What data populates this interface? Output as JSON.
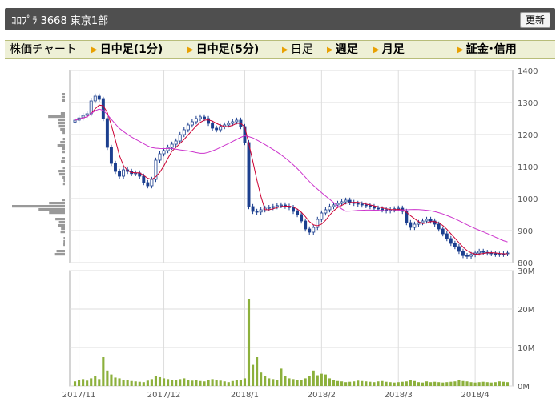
{
  "header": {
    "title": "ｺﾛﾌﾟﾗ  3668  東京1部",
    "refresh_label": "更新"
  },
  "tabs": [
    {
      "label": "株価チャート",
      "link": false
    },
    {
      "label": "日中足(1分)",
      "link": true
    },
    {
      "label": "日中足(5分)",
      "link": true
    },
    {
      "label": "日足",
      "link": false
    },
    {
      "label": "週足",
      "link": true
    },
    {
      "label": "月足",
      "link": true
    },
    {
      "label": "証金･信用",
      "link": true
    }
  ],
  "colors": {
    "up_candle": "#ffffff",
    "down_candle": "#1c3f8f",
    "ma_short": "#cc0033",
    "ma_long": "#cc33cc",
    "volume": "#8cb03c",
    "volume_profile": "#999999"
  },
  "chart_data": {
    "type": "candlestick",
    "ylim": [
      800,
      1400
    ],
    "price_ticks": [
      800,
      900,
      1000,
      1100,
      1200,
      1300,
      1400
    ],
    "volume_ylim": [
      0,
      30000000
    ],
    "volume_ticks": [
      "0M",
      "10M",
      "20M",
      "30M"
    ],
    "x_labels": [
      "2017/11",
      "2017/12",
      "2018/1",
      "2018/2",
      "2018/3",
      "2018/4"
    ],
    "x_label_index": [
      1,
      22,
      42,
      61,
      80,
      99
    ],
    "series": [
      {
        "name": "close",
        "values": [
          1245,
          1252,
          1260,
          1265,
          1305,
          1320,
          1310,
          1250,
          1160,
          1110,
          1085,
          1070,
          1090,
          1085,
          1078,
          1080,
          1070,
          1050,
          1040,
          1060,
          1120,
          1140,
          1150,
          1160,
          1170,
          1180,
          1200,
          1215,
          1230,
          1240,
          1250,
          1255,
          1250,
          1235,
          1220,
          1215,
          1225,
          1230,
          1235,
          1240,
          1245,
          1225,
          1175,
          975,
          960,
          958,
          965,
          970,
          972,
          975,
          978,
          980,
          976,
          972,
          960,
          950,
          930,
          905,
          895,
          910,
          935,
          955,
          965,
          975,
          980,
          985,
          990,
          995,
          988,
          985,
          983,
          980,
          978,
          975,
          970,
          968,
          965,
          962,
          965,
          968,
          970,
          960,
          925,
          910,
          920,
          925,
          930,
          935,
          930,
          920,
          905,
          890,
          875,
          860,
          850,
          835,
          822,
          820,
          825,
          830,
          835,
          832,
          830,
          828,
          826,
          826,
          828,
          830
        ]
      },
      {
        "name": "volume",
        "values": [
          1.2,
          1.5,
          1.8,
          1.4,
          2.0,
          2.5,
          1.8,
          7.5,
          4.0,
          3.0,
          2.2,
          2.0,
          1.6,
          1.5,
          1.3,
          1.2,
          1.1,
          1.0,
          1.4,
          1.8,
          2.5,
          2.3,
          2.0,
          1.8,
          1.6,
          1.5,
          1.8,
          2.0,
          1.6,
          1.4,
          1.5,
          1.3,
          1.2,
          1.5,
          1.8,
          1.6,
          1.4,
          1.2,
          1.0,
          1.3,
          1.5,
          1.5,
          2.0,
          22.5,
          5.5,
          7.5,
          3.5,
          2.5,
          2.0,
          1.8,
          1.5,
          4.5,
          2.5,
          2.0,
          1.8,
          1.6,
          1.5,
          2.0,
          2.5,
          4.0,
          2.8,
          3.2,
          3.0,
          2.0,
          1.5,
          1.3,
          1.2,
          1.0,
          1.1,
          1.2,
          1.4,
          1.3,
          1.2,
          1.1,
          1.0,
          1.2,
          1.3,
          1.1,
          1.0,
          0.9,
          1.0,
          1.1,
          1.2,
          1.5,
          1.3,
          1.0,
          0.9,
          1.2,
          1.0,
          1.1,
          1.0,
          0.9,
          1.0,
          1.1,
          1.2,
          1.5,
          1.3,
          1.2,
          1.0,
          0.9,
          1.0,
          1.1,
          1.0,
          0.9,
          1.0,
          1.2,
          1.1,
          1.0
        ]
      }
    ]
  }
}
